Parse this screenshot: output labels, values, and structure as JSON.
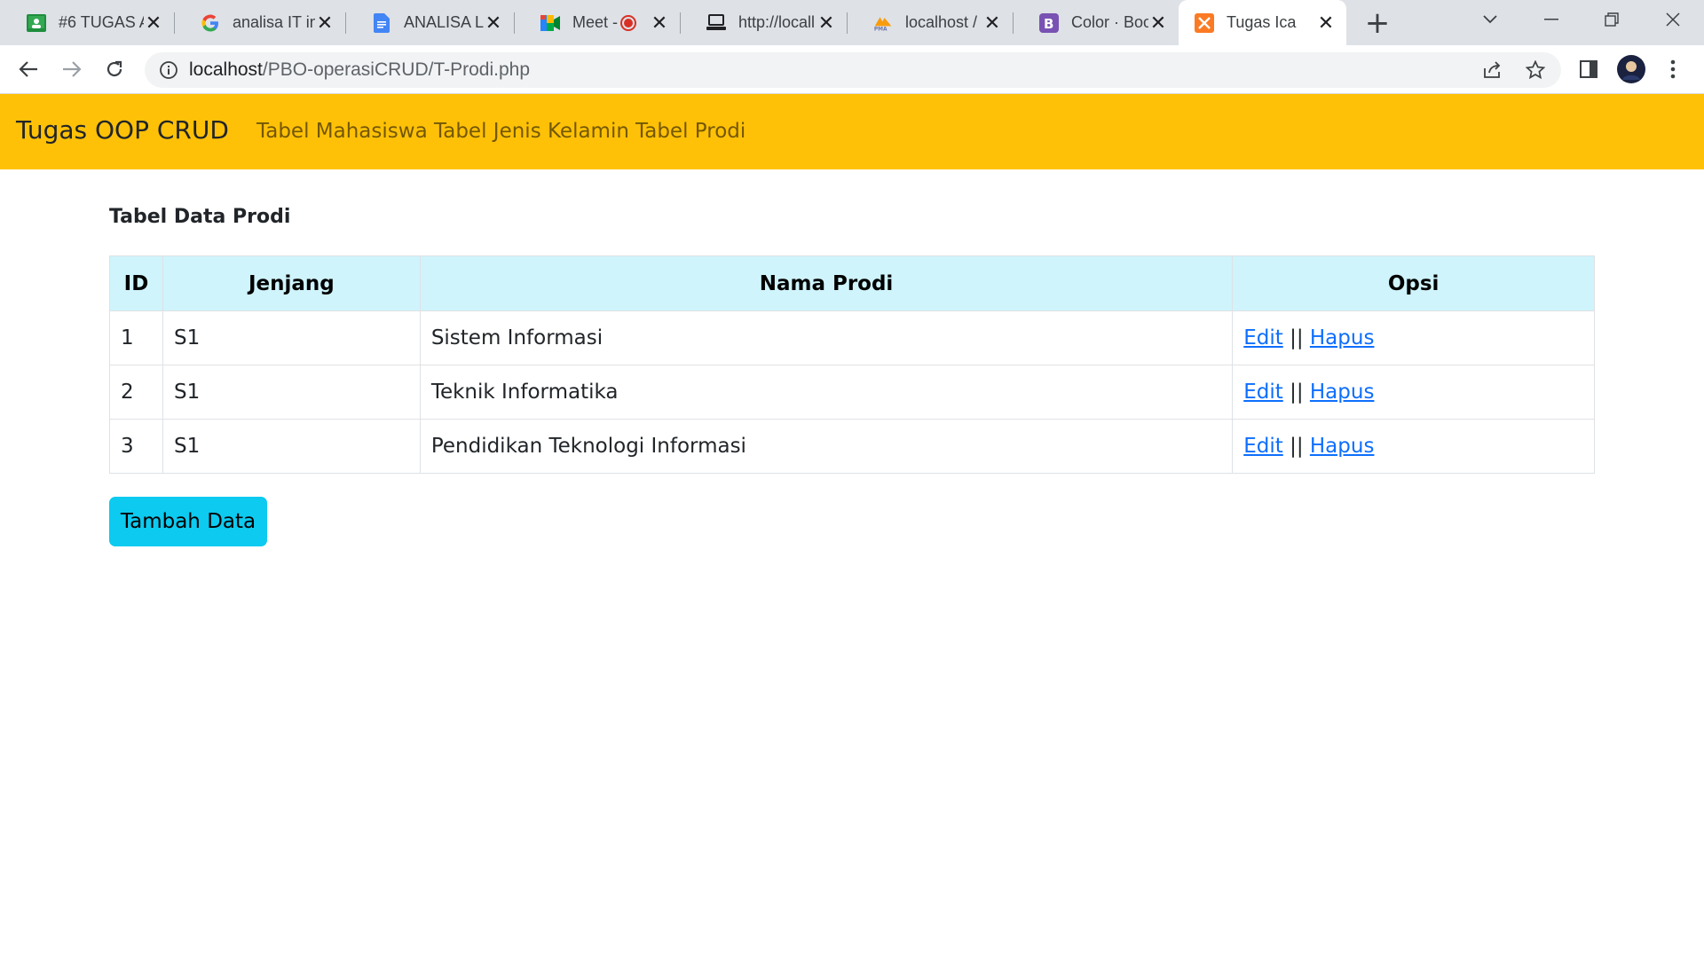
{
  "browser": {
    "tabs": [
      {
        "title": "#6 TUGAS A",
        "icon": "classroom-icon",
        "active": false
      },
      {
        "title": "analisa IT in",
        "icon": "google-icon",
        "active": false
      },
      {
        "title": "ANALISA LI",
        "icon": "docs-icon",
        "active": false
      },
      {
        "title": "Meet -",
        "icon": "meet-icon",
        "active": false
      },
      {
        "title": "http://locall",
        "icon": "page-icon",
        "active": false
      },
      {
        "title": "localhost /",
        "icon": "phpmyadmin-icon",
        "active": false
      },
      {
        "title": "Color · Boo",
        "icon": "bootstrap-icon",
        "active": false
      },
      {
        "title": "Tugas Ica",
        "icon": "xampp-icon",
        "active": true
      }
    ],
    "url_host": "localhost",
    "url_path": "/PBO-operasiCRUD/T-Prodi.php"
  },
  "navbar": {
    "brand": "Tugas OOP CRUD",
    "links": [
      "Tabel Mahasiswa",
      "Tabel Jenis Kelamin",
      "Tabel Prodi"
    ],
    "color": "#ffc107"
  },
  "main": {
    "heading": "Tabel Data Prodi",
    "table": {
      "headers": [
        "ID",
        "Jenjang",
        "Nama Prodi",
        "Opsi"
      ],
      "rows": [
        {
          "id": "1",
          "jenjang": "S1",
          "nama_prodi": "Sistem Informasi",
          "edit": "Edit",
          "sep": "||",
          "hapus": "Hapus"
        },
        {
          "id": "2",
          "jenjang": "S1",
          "nama_prodi": "Teknik Informatika",
          "edit": "Edit",
          "sep": "||",
          "hapus": "Hapus"
        },
        {
          "id": "3",
          "jenjang": "S1",
          "nama_prodi": "Pendidikan Teknologi Informasi",
          "edit": "Edit",
          "sep": "||",
          "hapus": "Hapus"
        }
      ],
      "header_color": "#cff4fc"
    },
    "add_button": "Tambah Data",
    "add_button_color": "#0dcaf0"
  }
}
